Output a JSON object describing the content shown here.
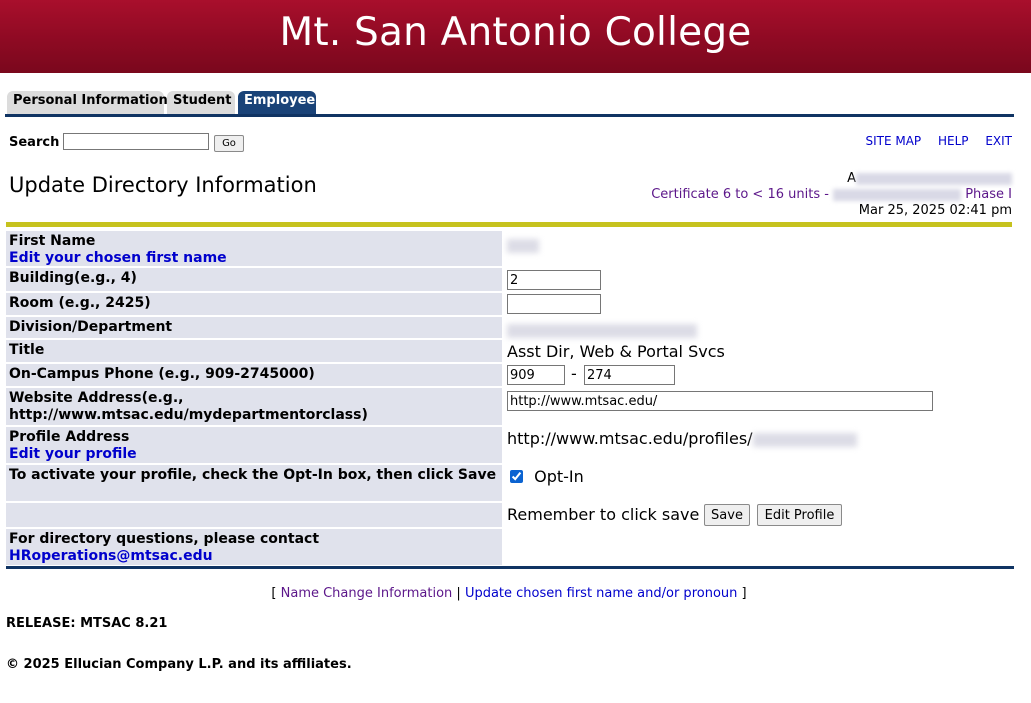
{
  "banner": {
    "title": "Mt. San Antonio College"
  },
  "tabs": [
    {
      "label": "Personal Information",
      "active": false
    },
    {
      "label": "Student",
      "active": false
    },
    {
      "label": "Employee",
      "active": true
    }
  ],
  "search": {
    "label": "Search",
    "value": "",
    "go_label": "Go"
  },
  "top_links": {
    "site_map": "SITE MAP",
    "help": "HELP",
    "exit": "EXIT"
  },
  "page": {
    "title": "Update Directory Information"
  },
  "user": {
    "name_prefix": "A",
    "certificate": "Certificate 6 to < 16 units -",
    "phase": "Phase I",
    "datetime": "Mar 25, 2025 02:41 pm"
  },
  "form": {
    "first_name": {
      "label": "First Name",
      "edit_link": "Edit your chosen first name"
    },
    "building": {
      "label": "Building(e.g., 4)",
      "value": "2"
    },
    "room": {
      "label": "Room (e.g., 2425)",
      "value": ""
    },
    "division": {
      "label": "Division/Department"
    },
    "title": {
      "label": "Title",
      "value": "Asst Dir, Web & Portal Svcs"
    },
    "phone": {
      "label": "On-Campus Phone (e.g., 909-2745000)",
      "area": "909",
      "separator": "-",
      "number": "274"
    },
    "website": {
      "label": "Website Address(e.g., http://www.mtsac.edu/mydepartmentorclass)",
      "value": "http://www.mtsac.edu/"
    },
    "profile": {
      "label": "Profile Address",
      "edit_link": "Edit your profile",
      "value": "http://www.mtsac.edu/profiles/"
    },
    "optin": {
      "label": "To activate your profile, check the Opt-In box, then click Save",
      "checkbox_label": "Opt-In",
      "checked": true
    },
    "save_row": {
      "text": "Remember to click save",
      "save_label": "Save",
      "edit_profile_label": "Edit Profile"
    },
    "contact": {
      "label": "For directory questions, please contact",
      "email": "HRoperations@mtsac.edu"
    }
  },
  "bottom_links": {
    "open": "[",
    "name_change": "Name Change Information",
    "divider": "|",
    "chosen_name": "Update chosen first name and/or pronoun",
    "close": "]"
  },
  "release": "RELEASE: MTSAC 8.21",
  "copyright": "© 2025 Ellucian Company L.P. and its affiliates."
}
